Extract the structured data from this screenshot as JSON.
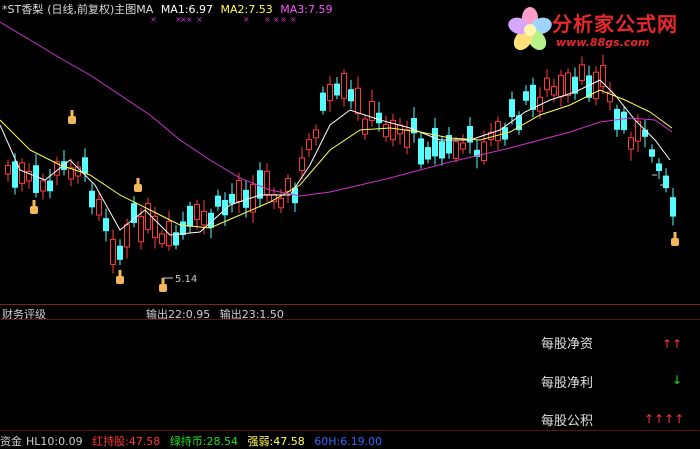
{
  "header": {
    "stock": "*ST香梨",
    "period": "(日线,前复权)",
    "indicator": "主图MA",
    "ma1": "MA1:6.97",
    "ma2": "MA2:7.53",
    "ma3": "MA3:7.59",
    "colors": {
      "stock": "#dcdcdc",
      "ma1": "#ffffff",
      "ma2": "#ffff55",
      "ma3": "#ff55ff"
    }
  },
  "logo": {
    "name": "分析家公式网",
    "url": "www.88gs.com",
    "color": "#e8282c"
  },
  "chart": {
    "low_label": "5.14",
    "up_color": "#ff3a3a",
    "down_color": "#55ffff",
    "ma1_color": "#ffffff",
    "ma2_color": "#ffff55",
    "ma3_color": "#cc33cc",
    "hand_icon": "hand-pointer-icon",
    "marker_symbol": "×"
  },
  "panel": {
    "title": "财务评级",
    "output1": "输出22:0.95",
    "output2": "输出23:1.50"
  },
  "rows": [
    {
      "label": "每股净资",
      "arrows": "↑↑",
      "color": "#ff3333"
    },
    {
      "label": "每股净利",
      "arrows": "↓",
      "color": "#22dd22"
    },
    {
      "label": "每股公积",
      "arrows": "↑↑↑↑",
      "color": "#ff3333"
    }
  ],
  "footer": {
    "item1": "资金",
    "item2": "HL10:0.09",
    "item3": "红持股:47.58",
    "item4": "绿持币:28.54",
    "item5": "强弱:47.58",
    "item6": "60H:6.19.00",
    "colors": {
      "item1": "#cccccc",
      "item2": "#cccccc",
      "item3": "#ff3333",
      "item4": "#22dd22",
      "item5": "#ffff55",
      "item6": "#3366ff"
    }
  }
}
